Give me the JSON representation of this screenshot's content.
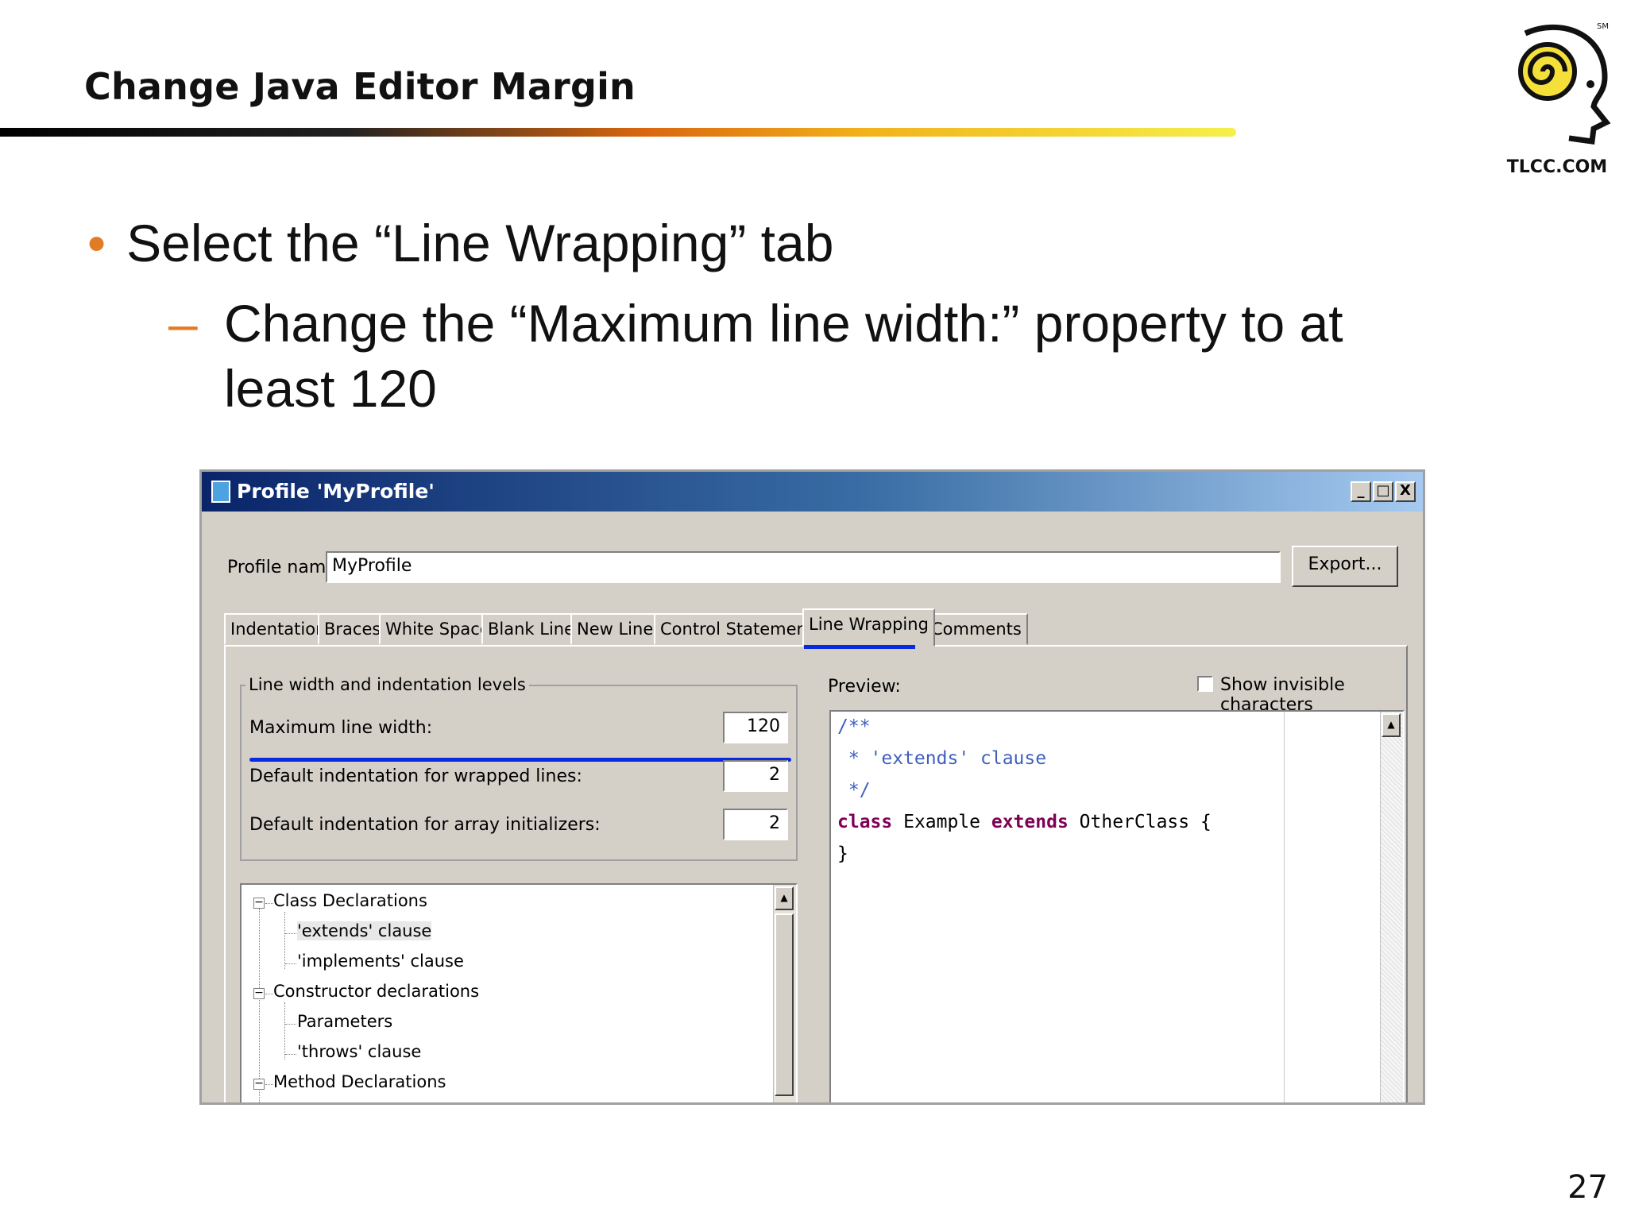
{
  "slide": {
    "title": "Change Java Editor Margin",
    "bullet_marker": "•",
    "bullet1": "Select the “Line Wrapping” tab",
    "sub_marker": "–",
    "bullet2": "Change the “Maximum line width:” property to at least 120",
    "page_number": "27",
    "logo_text": "TLCC.COM",
    "logo_mark": "SM",
    "colors": {
      "accent": "#e07b26",
      "highlight": "#0a2ae0"
    }
  },
  "dialog": {
    "title": "Profile 'MyProfile'",
    "window_buttons": {
      "minimize": "_",
      "maximize": "□",
      "close": "X"
    },
    "profile_name_label": "Profile name:",
    "profile_name_value": "MyProfile",
    "export_button": "Export...",
    "tabs": [
      {
        "label": "Indentation"
      },
      {
        "label": "Braces"
      },
      {
        "label": "White Space"
      },
      {
        "label": "Blank Lines"
      },
      {
        "label": "New Lines"
      },
      {
        "label": "Control Statements"
      },
      {
        "label": "Line Wrapping",
        "active": true
      },
      {
        "label": "Comments"
      }
    ],
    "group_title": "Line width and indentation levels",
    "fields": [
      {
        "label": "Maximum line width:",
        "value": "120"
      },
      {
        "label": "Default indentation for wrapped lines:",
        "value": "2"
      },
      {
        "label": "Default indentation for array initializers:",
        "value": "2"
      }
    ],
    "tree": [
      {
        "label": "Class Declarations",
        "expander": "−"
      },
      {
        "label": "'extends' clause",
        "selected": true
      },
      {
        "label": "'implements' clause"
      },
      {
        "label": "Constructor declarations",
        "expander": "−"
      },
      {
        "label": "Parameters"
      },
      {
        "label": "'throws' clause"
      },
      {
        "label": "Method Declarations",
        "expander": "−"
      }
    ],
    "scroll_up_arrow": "▲",
    "preview_label": "Preview:",
    "show_invisible_label": "Show invisible characters",
    "code": {
      "line1": "/**",
      "line2": " * 'extends' clause",
      "line3": " */",
      "line4_kw1": "class",
      "line4_name": " Example ",
      "line4_kw2": "extends",
      "line4_rest": " OtherClass {",
      "line5": "}"
    }
  }
}
